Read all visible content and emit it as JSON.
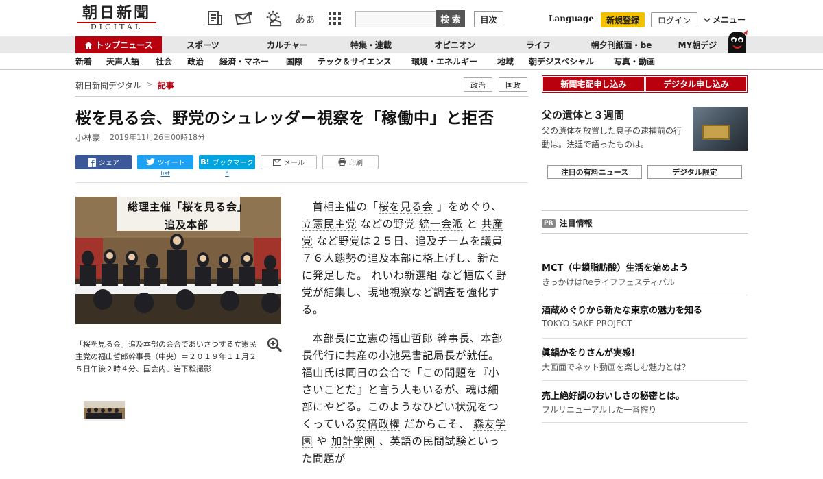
{
  "header": {
    "logo_main": "朝日新聞",
    "logo_sub": "DIGITAL",
    "search_placeholder": "",
    "search_button": "検 索",
    "toc_button": "目次",
    "language": "Language",
    "register": "新規登録",
    "login": "ログイン",
    "menu": "メニュー",
    "text_size_label": "あぁ",
    "icons": [
      "paper-icon",
      "mail-bag-icon",
      "weather-icon",
      "text-size-icon",
      "grid-icon"
    ]
  },
  "nav_primary": [
    {
      "label": "トップニュース"
    },
    {
      "label": "スポーツ"
    },
    {
      "label": "カルチャー"
    },
    {
      "label": "特集・連載"
    },
    {
      "label": "オピニオン"
    },
    {
      "label": "ライフ"
    },
    {
      "label": "朝夕刊紙面・be"
    },
    {
      "label": "MY朝デジ"
    }
  ],
  "nav_secondary": [
    {
      "label": "新着"
    },
    {
      "label": "天声人語"
    },
    {
      "label": "社会"
    },
    {
      "label": "政治"
    },
    {
      "label": "経済・マネー"
    },
    {
      "label": "国際"
    },
    {
      "label": "テック＆サイエンス"
    },
    {
      "label": "環境・エネルギー"
    },
    {
      "label": "地域"
    },
    {
      "label": "朝デジスペシャル"
    },
    {
      "label": "写真・動画"
    }
  ],
  "breadcrumb": {
    "home": "朝日新聞デジタル",
    "separator": ">",
    "current": "記事"
  },
  "tags": [
    "政治",
    "国政"
  ],
  "article": {
    "headline": "桜を見る会、野党のシュレッダー視察を「稼働中」と拒否",
    "author": "小林豪",
    "date": "2019年11月26日00時18分",
    "photo_banner_1": "総理主催「桜を見る会」",
    "photo_banner_2": "追及本部",
    "caption": "「桜を見る会」追及本部の会合であいさつする立憲民主党の福山哲郎幹事長（中央）＝２０１９年１１月２５日午後２時４分、国会内、岩下毅撮影",
    "p1": {
      "t1": "首相主催の「",
      "k1": "桜を見る会",
      "t2": "」をめぐり、",
      "k2": "立憲民主党",
      "t3": "などの野党",
      "k3": "統一会派",
      "t4": "と",
      "k4": "共産党",
      "t5": "など野党は２５日、追及チームを議員７６人態勢の追及本部に格上げし、新たに発足した。",
      "k5": "れいわ新選組",
      "t6": "など幅広く野党が結集し、現地視察など調査を強化する。"
    },
    "p2": {
      "t1": "本部長に立憲の",
      "k1": "福山哲郎",
      "t2": "幹事長、本部長代行に共産の小池晃書記局長が就任。福山氏は同日の会合で「この問題を『小さいことだ』と言う人もいるが、魂は細部にやどる。このようなひどい状況をつくっている",
      "k2": "安倍政権",
      "t3": "だからこそ、",
      "k3": "森友学園",
      "t4": "や",
      "k4": "加計学園",
      "t5": "、英語の民間試験といった問題が"
    }
  },
  "share": {
    "facebook": "シェア",
    "twitter": "ツイート",
    "twitter_sub": "list",
    "hatena": "ブックマーク",
    "hatena_count": "5",
    "mail": "メール",
    "print": "印刷"
  },
  "sidebar": {
    "promo_home": "新聞宅配申し込み",
    "promo_digital": "デジタル申し込み",
    "feature_title": "父の遺体と３週間",
    "feature_text": "父の遺体を放置した息子の逮捕前の行動は。法廷で語ったものは。",
    "tab_paid": "注目の有料ニュース",
    "tab_digital": "デジタル限定",
    "pr_badge": "PR",
    "pr_heading": "注目情報",
    "pr_items": [
      {
        "title": "MCT（中鎖脂肪酸）生活を始めよう",
        "sub": "きっかけはReライフフェスティバル"
      },
      {
        "title": "酒蔵めぐりから新たな東京の魅力を知る",
        "sub": "TOKYO SAKE PROJECT"
      },
      {
        "title": "眞鍋かをりさんが実感！",
        "sub": "大画面でネット動画を楽しむ魅力とは？"
      },
      {
        "title": "売上絶好調のおいしさの秘密とは。",
        "sub": "フルリニューアルした一番搾り"
      }
    ]
  },
  "colors": {
    "brand_red": "#b8000f",
    "register_yellow": "#f2c200",
    "facebook": "#3b5998",
    "twitter": "#1da1f2",
    "hatena": "#00a4de"
  }
}
